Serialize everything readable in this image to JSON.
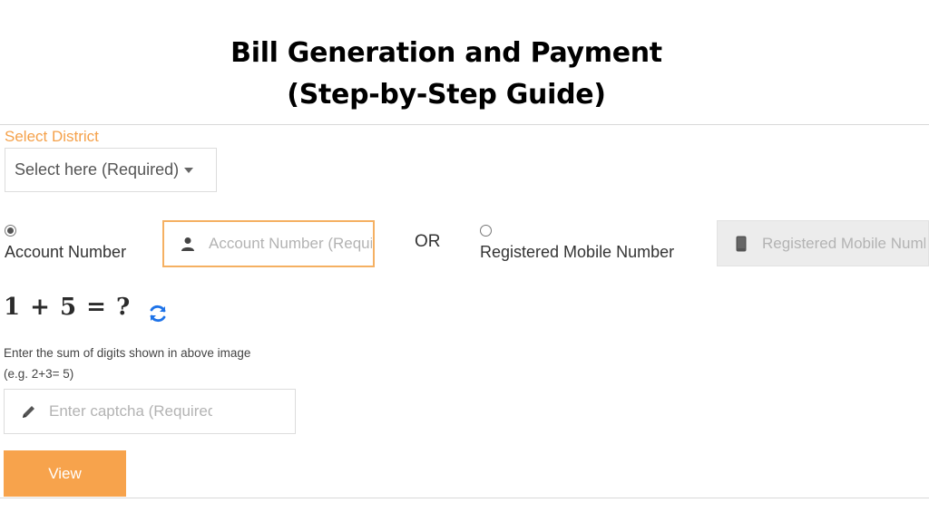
{
  "header": {
    "title_line1": "Bill Generation and Payment",
    "title_line2": "(Step-by-Step Guide)"
  },
  "district": {
    "label": "Select District",
    "select_value": "Select here (Required)"
  },
  "account": {
    "radio_label": "Account Number",
    "checked": true,
    "placeholder": "Account Number (Required)",
    "icon": "user-icon"
  },
  "or_label": "OR",
  "mobile": {
    "radio_label": "Registered Mobile Number",
    "checked": false,
    "placeholder": "Registered Mobile Number",
    "icon": "mobile-phone-icon"
  },
  "captcha": {
    "expression": "1 + 5 = ?",
    "refresh_icon": "refresh-icon",
    "hint_line1": "Enter the sum of digits shown in above image",
    "hint_line2": "(e.g. 2+3= 5)",
    "placeholder": "Enter captcha (Required)",
    "input_icon": "pencil-icon"
  },
  "view_button": "View",
  "colors": {
    "accent": "#f7a34c",
    "label_orange": "#f5a14a",
    "refresh_blue": "#1e73e8"
  }
}
